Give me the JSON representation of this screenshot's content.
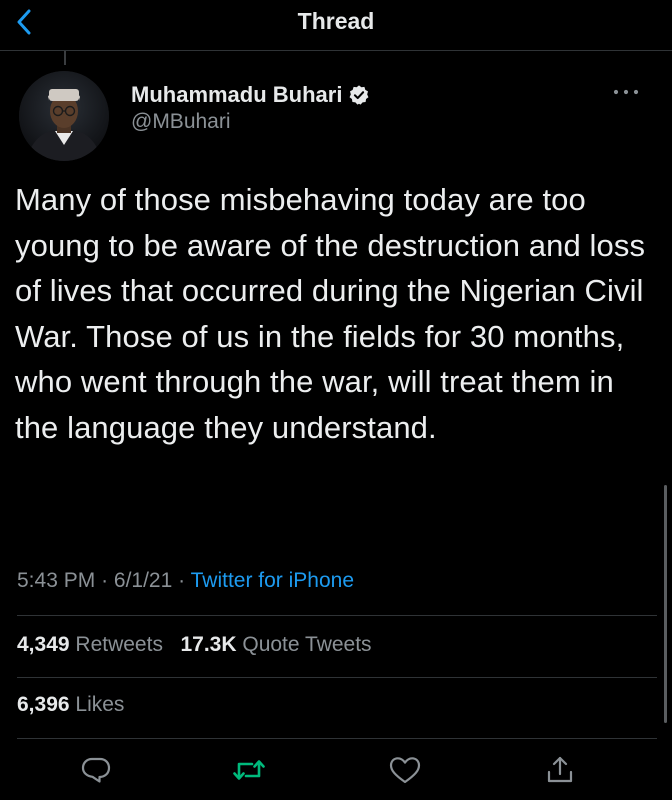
{
  "header": {
    "title": "Thread",
    "back_icon": "chevron-left-icon"
  },
  "tweet": {
    "author": {
      "name": "Muhammadu Buhari",
      "handle": "@MBuhari",
      "verified_icon": "verified-badge-icon"
    },
    "text": "Many of those misbehaving today are too young to be aware of the destruction and loss of lives that occurred during the Nigerian Civil War. Those of us in the fields for 30 months, who went through the war, will treat them in the language they understand.",
    "time": "5:43 PM",
    "date": "6/1/21",
    "separator": "·",
    "source": "Twitter for iPhone",
    "stats": {
      "retweets_count": "4,349",
      "retweets_label": "Retweets",
      "quotes_count": "17.3K",
      "quotes_label": "Quote Tweets",
      "likes_count": "6,396",
      "likes_label": "Likes"
    }
  },
  "actions": [
    "reply-icon",
    "retweet-icon",
    "like-icon",
    "share-icon"
  ],
  "colors": {
    "background": "#000000",
    "text": "#e7e9ea",
    "secondary": "#8b9196",
    "accent": "#1d9bf0",
    "retweet": "#00ba7c"
  }
}
